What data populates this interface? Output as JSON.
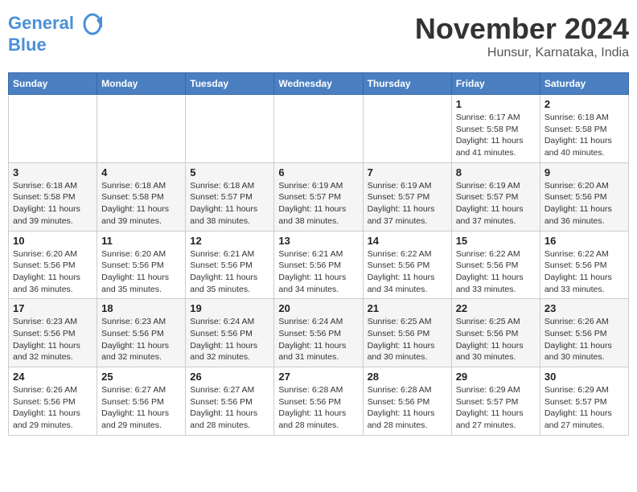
{
  "logo": {
    "line1": "General",
    "line2": "Blue"
  },
  "title": "November 2024",
  "location": "Hunsur, Karnataka, India",
  "days_of_week": [
    "Sunday",
    "Monday",
    "Tuesday",
    "Wednesday",
    "Thursday",
    "Friday",
    "Saturday"
  ],
  "weeks": [
    [
      {
        "day": "",
        "info": ""
      },
      {
        "day": "",
        "info": ""
      },
      {
        "day": "",
        "info": ""
      },
      {
        "day": "",
        "info": ""
      },
      {
        "day": "",
        "info": ""
      },
      {
        "day": "1",
        "info": "Sunrise: 6:17 AM\nSunset: 5:58 PM\nDaylight: 11 hours and 41 minutes."
      },
      {
        "day": "2",
        "info": "Sunrise: 6:18 AM\nSunset: 5:58 PM\nDaylight: 11 hours and 40 minutes."
      }
    ],
    [
      {
        "day": "3",
        "info": "Sunrise: 6:18 AM\nSunset: 5:58 PM\nDaylight: 11 hours and 39 minutes."
      },
      {
        "day": "4",
        "info": "Sunrise: 6:18 AM\nSunset: 5:58 PM\nDaylight: 11 hours and 39 minutes."
      },
      {
        "day": "5",
        "info": "Sunrise: 6:18 AM\nSunset: 5:57 PM\nDaylight: 11 hours and 38 minutes."
      },
      {
        "day": "6",
        "info": "Sunrise: 6:19 AM\nSunset: 5:57 PM\nDaylight: 11 hours and 38 minutes."
      },
      {
        "day": "7",
        "info": "Sunrise: 6:19 AM\nSunset: 5:57 PM\nDaylight: 11 hours and 37 minutes."
      },
      {
        "day": "8",
        "info": "Sunrise: 6:19 AM\nSunset: 5:57 PM\nDaylight: 11 hours and 37 minutes."
      },
      {
        "day": "9",
        "info": "Sunrise: 6:20 AM\nSunset: 5:56 PM\nDaylight: 11 hours and 36 minutes."
      }
    ],
    [
      {
        "day": "10",
        "info": "Sunrise: 6:20 AM\nSunset: 5:56 PM\nDaylight: 11 hours and 36 minutes."
      },
      {
        "day": "11",
        "info": "Sunrise: 6:20 AM\nSunset: 5:56 PM\nDaylight: 11 hours and 35 minutes."
      },
      {
        "day": "12",
        "info": "Sunrise: 6:21 AM\nSunset: 5:56 PM\nDaylight: 11 hours and 35 minutes."
      },
      {
        "day": "13",
        "info": "Sunrise: 6:21 AM\nSunset: 5:56 PM\nDaylight: 11 hours and 34 minutes."
      },
      {
        "day": "14",
        "info": "Sunrise: 6:22 AM\nSunset: 5:56 PM\nDaylight: 11 hours and 34 minutes."
      },
      {
        "day": "15",
        "info": "Sunrise: 6:22 AM\nSunset: 5:56 PM\nDaylight: 11 hours and 33 minutes."
      },
      {
        "day": "16",
        "info": "Sunrise: 6:22 AM\nSunset: 5:56 PM\nDaylight: 11 hours and 33 minutes."
      }
    ],
    [
      {
        "day": "17",
        "info": "Sunrise: 6:23 AM\nSunset: 5:56 PM\nDaylight: 11 hours and 32 minutes."
      },
      {
        "day": "18",
        "info": "Sunrise: 6:23 AM\nSunset: 5:56 PM\nDaylight: 11 hours and 32 minutes."
      },
      {
        "day": "19",
        "info": "Sunrise: 6:24 AM\nSunset: 5:56 PM\nDaylight: 11 hours and 32 minutes."
      },
      {
        "day": "20",
        "info": "Sunrise: 6:24 AM\nSunset: 5:56 PM\nDaylight: 11 hours and 31 minutes."
      },
      {
        "day": "21",
        "info": "Sunrise: 6:25 AM\nSunset: 5:56 PM\nDaylight: 11 hours and 30 minutes."
      },
      {
        "day": "22",
        "info": "Sunrise: 6:25 AM\nSunset: 5:56 PM\nDaylight: 11 hours and 30 minutes."
      },
      {
        "day": "23",
        "info": "Sunrise: 6:26 AM\nSunset: 5:56 PM\nDaylight: 11 hours and 30 minutes."
      }
    ],
    [
      {
        "day": "24",
        "info": "Sunrise: 6:26 AM\nSunset: 5:56 PM\nDaylight: 11 hours and 29 minutes."
      },
      {
        "day": "25",
        "info": "Sunrise: 6:27 AM\nSunset: 5:56 PM\nDaylight: 11 hours and 29 minutes."
      },
      {
        "day": "26",
        "info": "Sunrise: 6:27 AM\nSunset: 5:56 PM\nDaylight: 11 hours and 28 minutes."
      },
      {
        "day": "27",
        "info": "Sunrise: 6:28 AM\nSunset: 5:56 PM\nDaylight: 11 hours and 28 minutes."
      },
      {
        "day": "28",
        "info": "Sunrise: 6:28 AM\nSunset: 5:56 PM\nDaylight: 11 hours and 28 minutes."
      },
      {
        "day": "29",
        "info": "Sunrise: 6:29 AM\nSunset: 5:57 PM\nDaylight: 11 hours and 27 minutes."
      },
      {
        "day": "30",
        "info": "Sunrise: 6:29 AM\nSunset: 5:57 PM\nDaylight: 11 hours and 27 minutes."
      }
    ]
  ]
}
